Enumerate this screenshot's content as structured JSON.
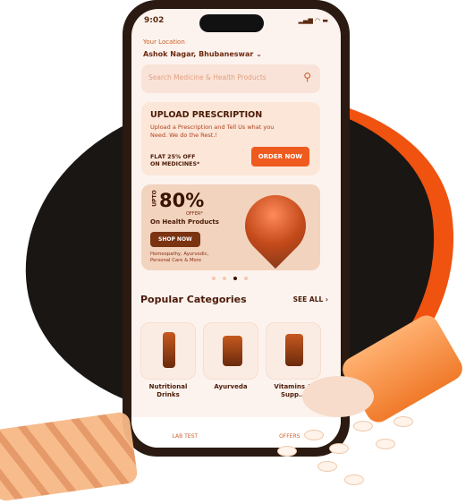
{
  "status_bar": {
    "time": "9:02",
    "icons": "signal wifi battery"
  },
  "location": {
    "label": "Your Location",
    "value": "Ashok Nagar, Bhubaneswar"
  },
  "search": {
    "placeholder": "Search Medicine & Health Products"
  },
  "upload_card": {
    "title": "UPLOAD PRESCRIPTION",
    "text": "Upload a Prescription and Tell Us what you Need. We do the Rest.!",
    "offer_line1": "FLAT 25% OFF",
    "offer_line2": "ON MEDICINES*",
    "button": "ORDER NOW"
  },
  "promo_banner": {
    "upto": "UPTO",
    "percent": "80%",
    "offer": "OFFER*",
    "subtitle": "On Health Products",
    "button": "SHOP NOW",
    "categories_line1": "Homeopathy, Ayurvedic,",
    "categories_line2": "Personal Care & More",
    "active_slide": 3,
    "slide_count": 4
  },
  "popular": {
    "title": "Popular Categories",
    "see_all": "SEE ALL",
    "items": [
      {
        "label": "Nutritional Drinks"
      },
      {
        "label": "Ayurveda"
      },
      {
        "label": "Vitamins & Supp..."
      }
    ]
  },
  "bottom_nav": {
    "items": [
      {
        "label": "LAB TEST"
      },
      {
        "label": "OFFERS"
      }
    ]
  },
  "colors": {
    "accent": "#ef5a1e",
    "blob": "#1a1614",
    "brown": "#7a3412"
  }
}
